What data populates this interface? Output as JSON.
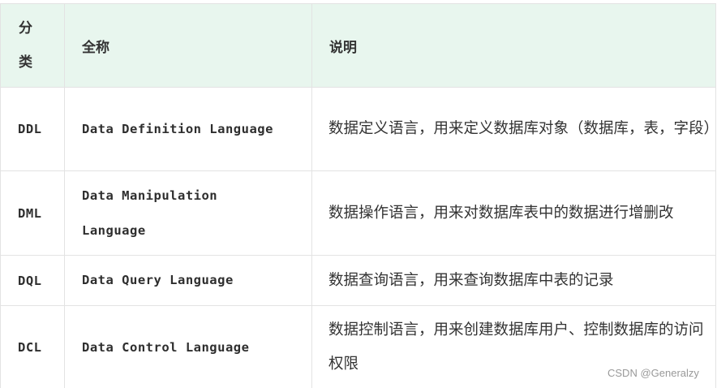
{
  "table": {
    "headers": {
      "category": "分类",
      "category_chars": [
        "分",
        "类"
      ],
      "full_name": "全称",
      "description": "说明"
    },
    "rows": [
      {
        "abbr": "DDL",
        "full_name": "Data Definition Language",
        "description": "数据定义语言，用来定义数据库对象（数据库，表，字段）"
      },
      {
        "abbr": "DML",
        "full_name": "Data Manipulation Language",
        "description": "数据操作语言，用来对数据库表中的数据进行增删改"
      },
      {
        "abbr": "DQL",
        "full_name": "Data Query Language",
        "description": "数据查询语言，用来查询数据库中表的记录"
      },
      {
        "abbr": "DCL",
        "full_name": "Data Control Language",
        "description": "数据控制语言，用来创建数据库用户、控制数据库的访问权限"
      }
    ]
  },
  "watermark": "CSDN @Generalzy"
}
